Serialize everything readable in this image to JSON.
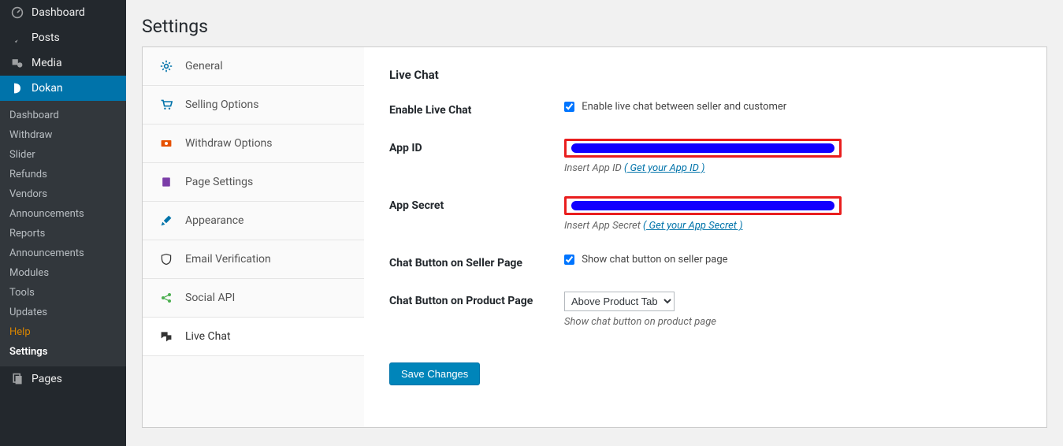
{
  "adminSidebar": {
    "menu": [
      {
        "label": "Dashboard",
        "name": "dashboard"
      },
      {
        "label": "Posts",
        "name": "posts"
      },
      {
        "label": "Media",
        "name": "media"
      },
      {
        "label": "Dokan",
        "name": "dokan",
        "current": true
      },
      {
        "label": "Pages",
        "name": "pages"
      }
    ],
    "submenu": [
      {
        "label": "Dashboard",
        "name": "sub-dashboard"
      },
      {
        "label": "Withdraw",
        "name": "sub-withdraw"
      },
      {
        "label": "Slider",
        "name": "sub-slider"
      },
      {
        "label": "Refunds",
        "name": "sub-refunds"
      },
      {
        "label": "Vendors",
        "name": "sub-vendors"
      },
      {
        "label": "Announcements",
        "name": "sub-announcements"
      },
      {
        "label": "Reports",
        "name": "sub-reports"
      },
      {
        "label": "Announcements",
        "name": "sub-announcements2"
      },
      {
        "label": "Modules",
        "name": "sub-modules"
      },
      {
        "label": "Tools",
        "name": "sub-tools"
      },
      {
        "label": "Updates",
        "name": "sub-updates"
      },
      {
        "label": "Help",
        "name": "sub-help",
        "hl": true
      },
      {
        "label": "Settings",
        "name": "sub-settings",
        "current": true
      }
    ]
  },
  "page": {
    "title": "Settings"
  },
  "tabs": [
    {
      "label": "General",
      "name": "tab-general"
    },
    {
      "label": "Selling Options",
      "name": "tab-selling-options"
    },
    {
      "label": "Withdraw Options",
      "name": "tab-withdraw-options"
    },
    {
      "label": "Page Settings",
      "name": "tab-page-settings"
    },
    {
      "label": "Appearance",
      "name": "tab-appearance"
    },
    {
      "label": "Email Verification",
      "name": "tab-email-verification"
    },
    {
      "label": "Social API",
      "name": "tab-social-api"
    },
    {
      "label": "Live Chat",
      "name": "tab-live-chat",
      "active": true
    }
  ],
  "content": {
    "heading": "Live Chat",
    "rows": {
      "enable": {
        "label": "Enable Live Chat",
        "checkbox": "Enable live chat between seller and customer",
        "checked": true
      },
      "appid": {
        "label": "App ID",
        "hint": "Insert App ID ",
        "link": "( Get your App ID )"
      },
      "appsecret": {
        "label": "App Secret",
        "hint": "Insert App Secret ",
        "link": "( Get your App Secret )"
      },
      "sellerpage": {
        "label": "Chat Button on Seller Page",
        "checkbox": "Show chat button on seller page",
        "checked": true
      },
      "productpage": {
        "label": "Chat Button on Product Page",
        "select": "Above Product Tab",
        "hint": "Show chat button on product page"
      }
    },
    "save": "Save Changes"
  }
}
